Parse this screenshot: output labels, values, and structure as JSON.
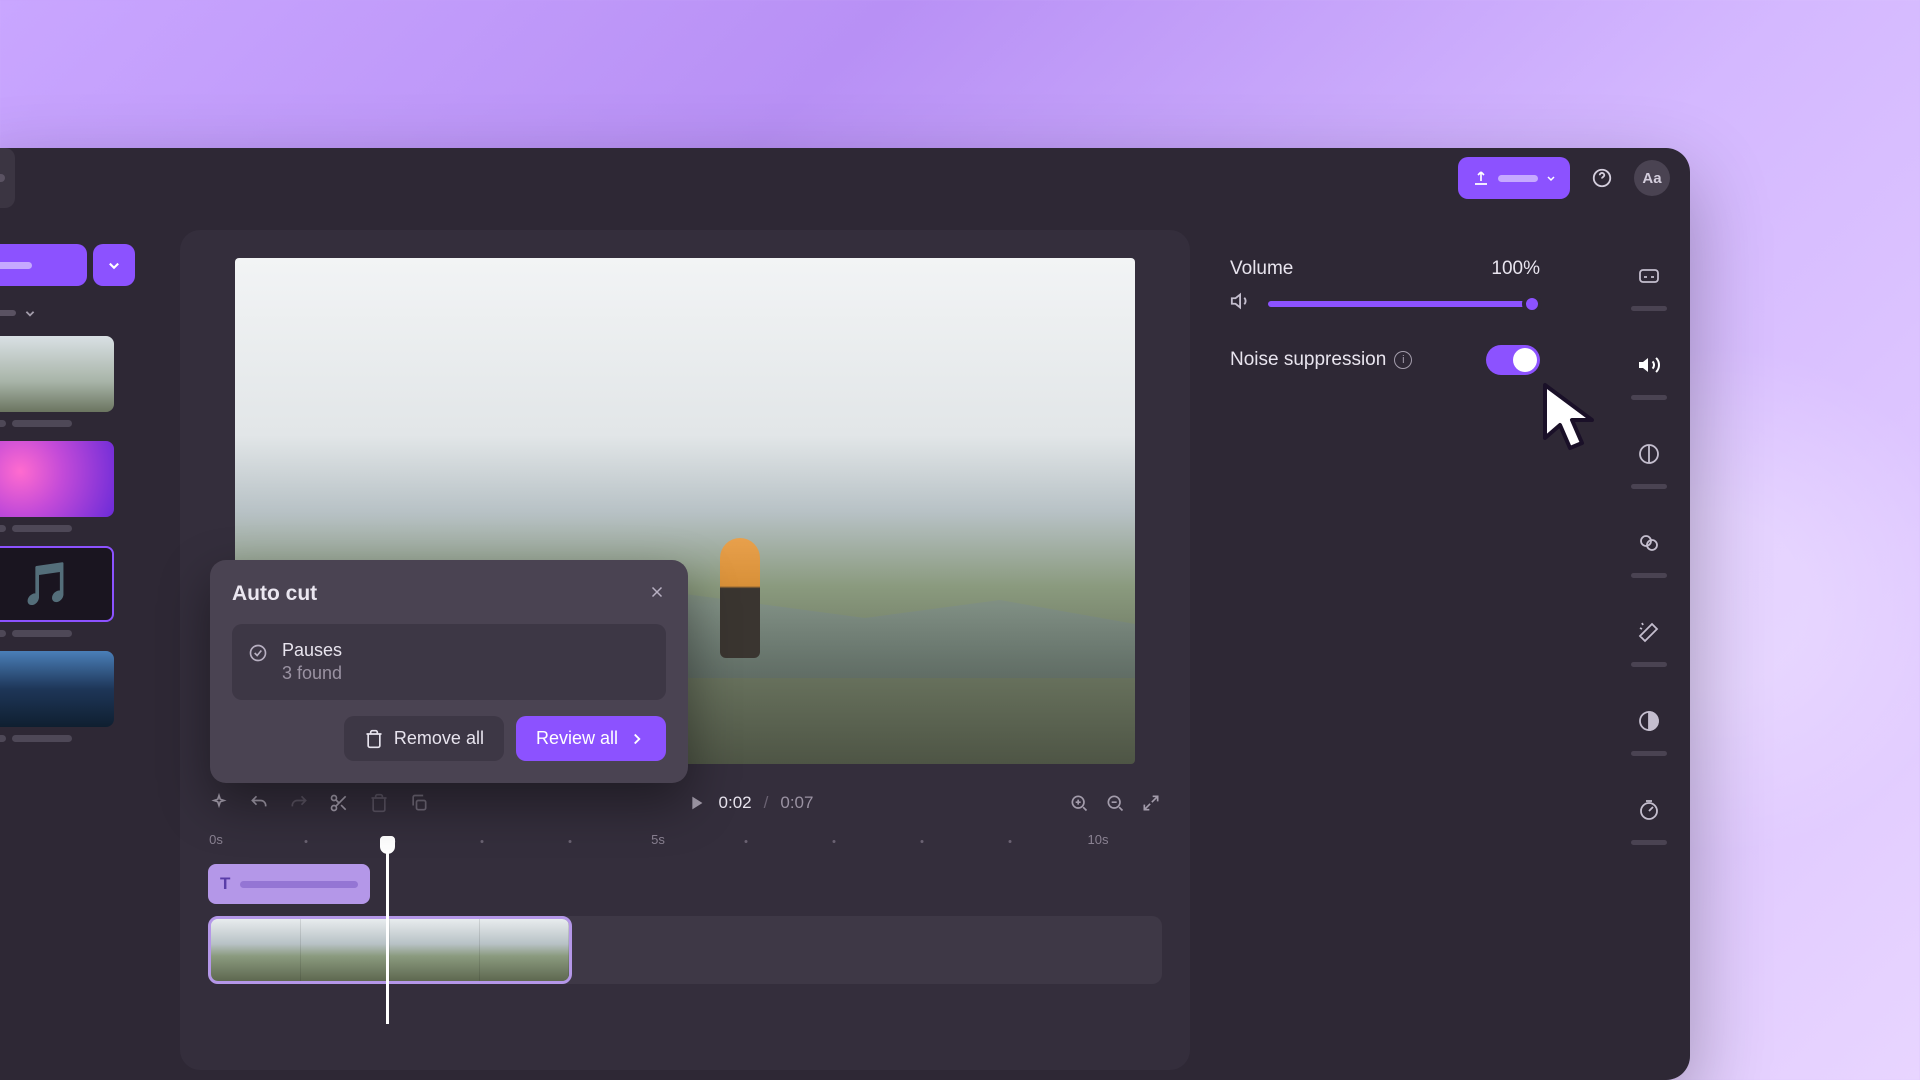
{
  "topbar": {
    "help_icon": "help-icon",
    "account_label": "Aa"
  },
  "autocut": {
    "title": "Auto cut",
    "pauses_label": "Pauses",
    "pauses_count": "3 found",
    "remove_all": "Remove all",
    "review_all": "Review all"
  },
  "playback": {
    "current_time": "0:02",
    "separator": "/",
    "total_time": "0:07"
  },
  "ruler": {
    "t0": "0s",
    "t5": "5s",
    "t10": "10s"
  },
  "properties": {
    "volume_label": "Volume",
    "volume_value": "100%",
    "noise_label": "Noise suppression"
  },
  "tracks": {
    "text_layer_symbol": "T"
  },
  "rail_icons": {
    "cc": "CC"
  },
  "colors": {
    "accent": "#8c52ff"
  }
}
